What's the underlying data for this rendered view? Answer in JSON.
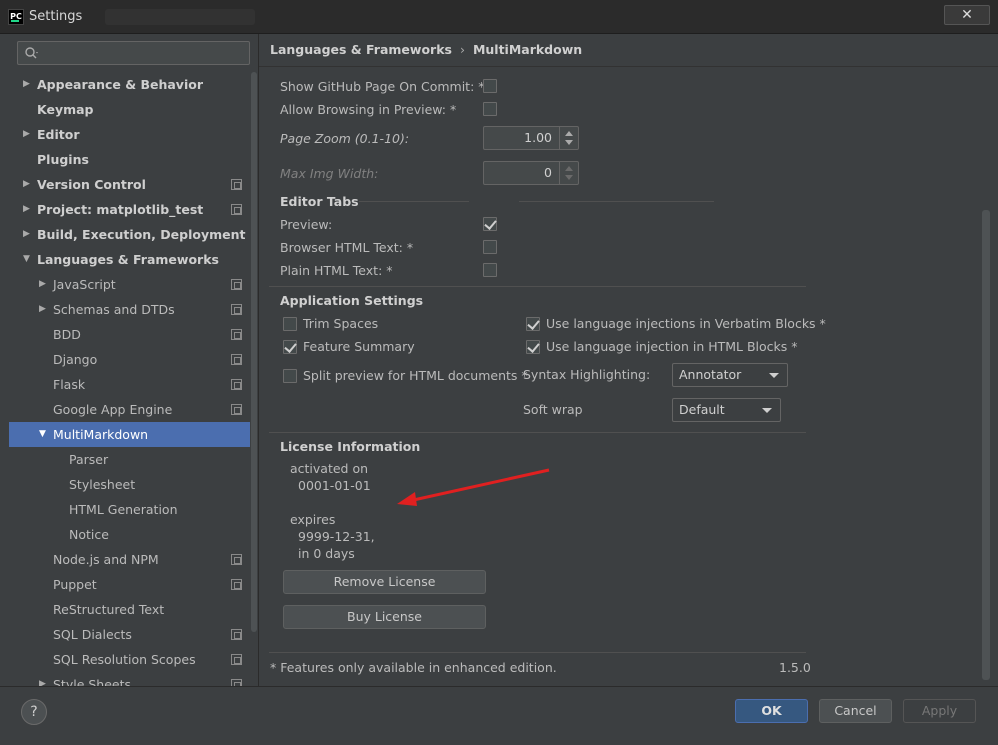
{
  "window": {
    "title": "Settings",
    "app_icon_text": "PC",
    "close_glyph": "✕"
  },
  "sidebar": {
    "search": {
      "placeholder": "",
      "value": ""
    },
    "items": [
      {
        "label": "Appearance & Behavior",
        "level": 0,
        "arrow": "▶",
        "bold": true,
        "page_icon": false
      },
      {
        "label": "Keymap",
        "level": 0,
        "arrow": "",
        "bold": true,
        "page_icon": false
      },
      {
        "label": "Editor",
        "level": 0,
        "arrow": "▶",
        "bold": true,
        "page_icon": false
      },
      {
        "label": "Plugins",
        "level": 0,
        "arrow": "",
        "bold": true,
        "page_icon": false
      },
      {
        "label": "Version Control",
        "level": 0,
        "arrow": "▶",
        "bold": true,
        "page_icon": true
      },
      {
        "label": "Project: matplotlib_test",
        "level": 0,
        "arrow": "▶",
        "bold": true,
        "page_icon": true
      },
      {
        "label": "Build, Execution, Deployment",
        "level": 0,
        "arrow": "▶",
        "bold": true,
        "page_icon": false
      },
      {
        "label": "Languages & Frameworks",
        "level": 0,
        "arrow": "▼",
        "bold": true,
        "page_icon": false
      },
      {
        "label": "JavaScript",
        "level": 1,
        "arrow": "▶",
        "bold": false,
        "page_icon": true
      },
      {
        "label": "Schemas and DTDs",
        "level": 1,
        "arrow": "▶",
        "bold": false,
        "page_icon": true
      },
      {
        "label": "BDD",
        "level": 1,
        "arrow": "",
        "bold": false,
        "page_icon": true
      },
      {
        "label": "Django",
        "level": 1,
        "arrow": "",
        "bold": false,
        "page_icon": true
      },
      {
        "label": "Flask",
        "level": 1,
        "arrow": "",
        "bold": false,
        "page_icon": true
      },
      {
        "label": "Google App Engine",
        "level": 1,
        "arrow": "",
        "bold": false,
        "page_icon": true
      },
      {
        "label": "MultiMarkdown",
        "level": 1,
        "arrow": "▼",
        "bold": false,
        "page_icon": false,
        "selected": true
      },
      {
        "label": "Parser",
        "level": 2,
        "arrow": "",
        "bold": false,
        "page_icon": false
      },
      {
        "label": "Stylesheet",
        "level": 2,
        "arrow": "",
        "bold": false,
        "page_icon": false
      },
      {
        "label": "HTML Generation",
        "level": 2,
        "arrow": "",
        "bold": false,
        "page_icon": false
      },
      {
        "label": "Notice",
        "level": 2,
        "arrow": "",
        "bold": false,
        "page_icon": false
      },
      {
        "label": "Node.js and NPM",
        "level": 1,
        "arrow": "",
        "bold": false,
        "page_icon": true
      },
      {
        "label": "Puppet",
        "level": 1,
        "arrow": "",
        "bold": false,
        "page_icon": true
      },
      {
        "label": "ReStructured Text",
        "level": 1,
        "arrow": "",
        "bold": false,
        "page_icon": false
      },
      {
        "label": "SQL Dialects",
        "level": 1,
        "arrow": "",
        "bold": false,
        "page_icon": true
      },
      {
        "label": "SQL Resolution Scopes",
        "level": 1,
        "arrow": "",
        "bold": false,
        "page_icon": true
      },
      {
        "label": "Style Sheets",
        "level": 1,
        "arrow": "▶",
        "bold": false,
        "page_icon": true
      }
    ]
  },
  "breadcrumb": {
    "parent": "Languages & Frameworks",
    "separator": "›",
    "current": "MultiMarkdown"
  },
  "preview_options": {
    "show_github": {
      "label": "Show GitHub Page On Commit: *",
      "checked": false
    },
    "allow_browsing": {
      "label": "Allow Browsing in Preview: *",
      "checked": false
    },
    "page_zoom": {
      "label": "Page Zoom (0.1-10):",
      "value": "1.00"
    },
    "max_img_width": {
      "label": "Max Img Width:",
      "value": "0"
    }
  },
  "editor_tabs": {
    "title": "Editor Tabs",
    "preview": {
      "label": "Preview:",
      "checked": true
    },
    "browser_html": {
      "label": "Browser HTML Text: *",
      "checked": false
    },
    "plain_html": {
      "label": "Plain HTML Text: *",
      "checked": false
    }
  },
  "application_settings": {
    "title": "Application Settings",
    "trim_spaces": {
      "label": "Trim Spaces",
      "checked": false
    },
    "feature_summary": {
      "label": "Feature Summary",
      "checked": true
    },
    "split_preview": {
      "label": "Split preview for HTML documents *",
      "checked": false
    },
    "lang_inj_verbatim": {
      "label": "Use language injections in Verbatim Blocks *",
      "checked": true
    },
    "lang_inj_html": {
      "label": "Use language injection in HTML Blocks *",
      "checked": true
    },
    "syntax_highlighting": {
      "label": "Syntax Highlighting:",
      "value": "Annotator"
    },
    "soft_wrap": {
      "label": "Soft wrap",
      "value": "Default"
    }
  },
  "license": {
    "title": "License Information",
    "activated_label": "activated on",
    "activated_date": "0001-01-01",
    "expires_label": "expires",
    "expires_date": "9999-12-31,",
    "expires_in": "in 0 days",
    "remove_button": "Remove License",
    "buy_button": "Buy License"
  },
  "footer": {
    "note": "* Features only available in enhanced edition.",
    "version": "1.5.0"
  },
  "buttons": {
    "help": "?",
    "ok": "OK",
    "cancel": "Cancel",
    "apply": "Apply"
  },
  "colors": {
    "selection": "#4b6eaf",
    "annotation_arrow": "#e02020"
  }
}
